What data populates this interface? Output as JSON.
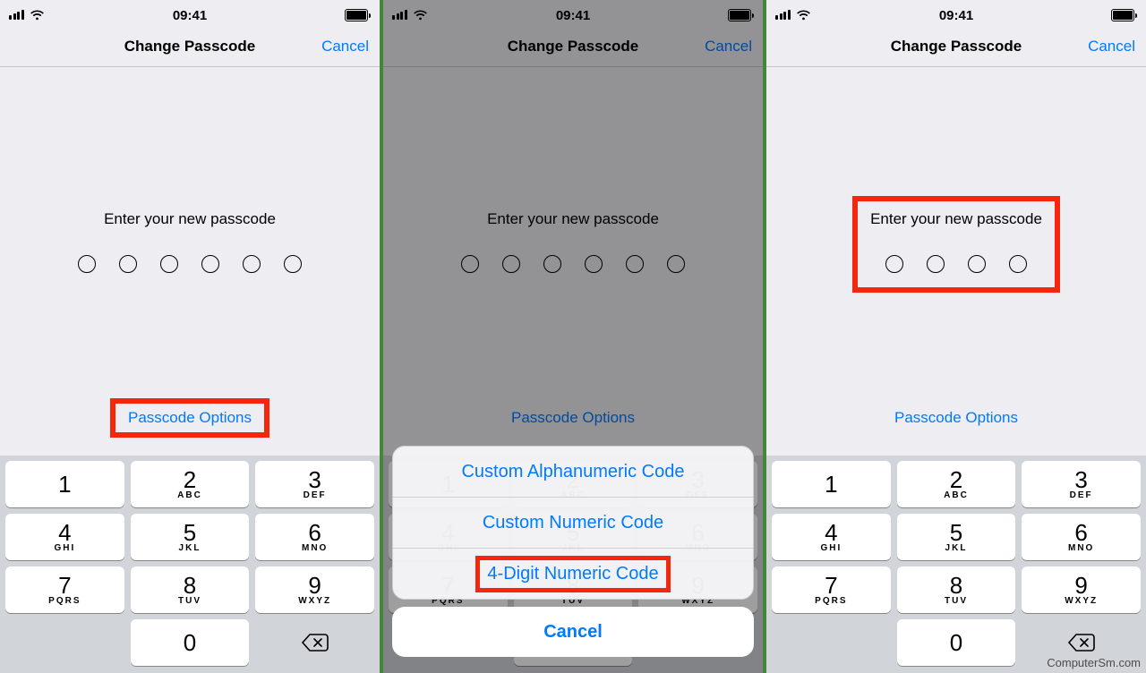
{
  "status_time": "09:41",
  "nav_title": "Change Passcode",
  "nav_cancel": "Cancel",
  "prompt": "Enter your new passcode",
  "options_link": "Passcode Options",
  "keypad": {
    "keys": [
      {
        "n": "1",
        "l": ""
      },
      {
        "n": "2",
        "l": "ABC"
      },
      {
        "n": "3",
        "l": "DEF"
      },
      {
        "n": "4",
        "l": "GHI"
      },
      {
        "n": "5",
        "l": "JKL"
      },
      {
        "n": "6",
        "l": "MNO"
      },
      {
        "n": "7",
        "l": "PQRS"
      },
      {
        "n": "8",
        "l": "TUV"
      },
      {
        "n": "9",
        "l": "WXYZ"
      },
      {
        "n": "0",
        "l": ""
      }
    ],
    "delete_glyph": "⌫"
  },
  "action_sheet": {
    "options": [
      "Custom Alphanumeric Code",
      "Custom Numeric Code",
      "4-Digit Numeric Code"
    ],
    "cancel": "Cancel",
    "highlight_index": 2
  },
  "screens": [
    {
      "dots": 6,
      "highlight_options": true,
      "highlight_prompt": false
    },
    {
      "dots": 6,
      "show_sheet": true
    },
    {
      "dots": 4,
      "highlight_options": false,
      "highlight_prompt": true
    }
  ],
  "watermark": "ComputerSm.com"
}
